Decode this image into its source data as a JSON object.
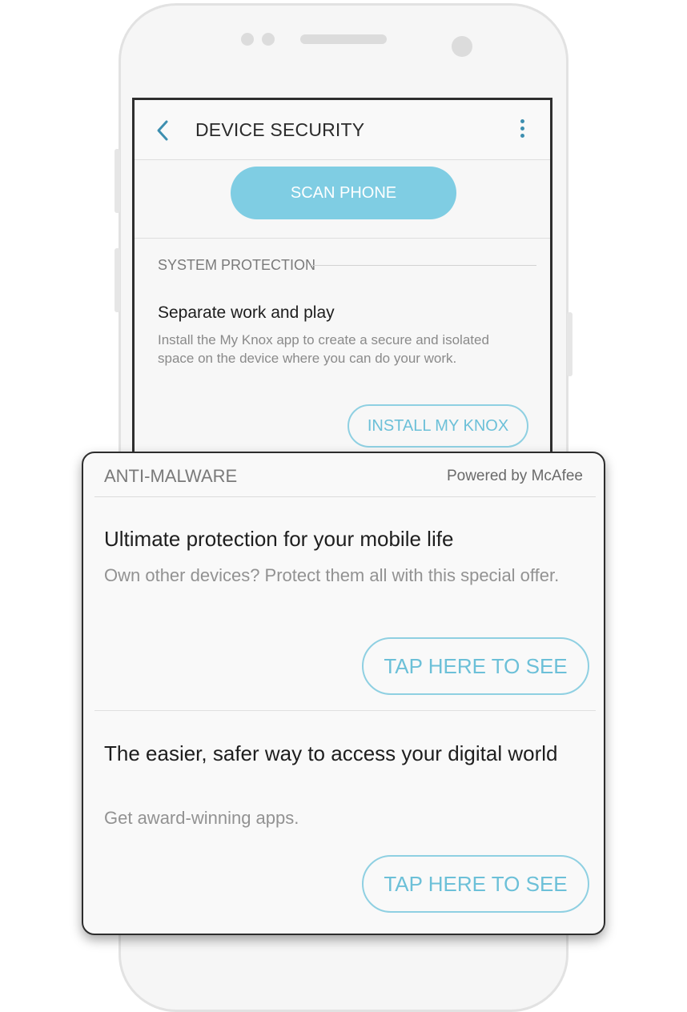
{
  "app_bar": {
    "back_icon": "chevron-left-icon",
    "title": "DEVICE SECURITY",
    "menu_icon": "more-vertical-icon",
    "accent": "#3d8fb0"
  },
  "scan": {
    "label": "SCAN PHONE",
    "color": "#7fcde3"
  },
  "system_protection": {
    "header": "SYSTEM PROTECTION",
    "title": "Separate work and play",
    "description": "Install the My Knox app to create a secure and isolated space on the device where you can do your work.",
    "button_label": "INSTALL MY KNOX"
  },
  "anti_malware": {
    "header": "ANTI-MALWARE",
    "powered_by": "Powered by McAfee",
    "offers": [
      {
        "title": "Ultimate protection for your mobile life",
        "description": "Own other devices? Protect them all with this special offer.",
        "button_label": "TAP HERE TO SEE"
      },
      {
        "title": "The easier, safer way to access your digital world",
        "description": "Get award-winning apps.",
        "button_label": "TAP HERE TO SEE"
      }
    ],
    "button_color": "#6cc0d8"
  }
}
